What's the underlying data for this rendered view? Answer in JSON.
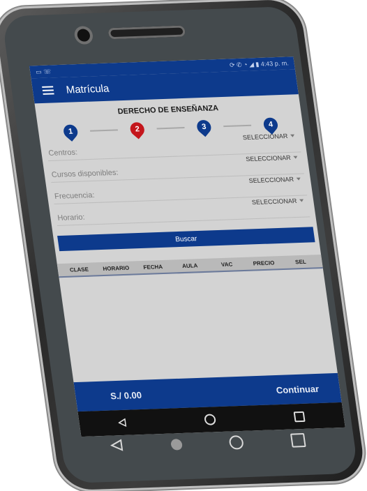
{
  "status_bar": {
    "left_icons": "▭ ☏",
    "right_text": "⟳ ✆ ◔ ◢ ▮ 4:43 p. m."
  },
  "app_bar": {
    "title": "Matrícula",
    "menu_icon": "hamburger-icon"
  },
  "section": {
    "title": "DERECHO DE ENSEÑANZA"
  },
  "steps": [
    {
      "label": "1",
      "active": false
    },
    {
      "label": "2",
      "active": true
    },
    {
      "label": "3",
      "active": false
    },
    {
      "label": "4",
      "active": false
    }
  ],
  "form": {
    "rows": [
      {
        "label": "Centros:",
        "value": "SELECCIONAR"
      },
      {
        "label": "Cursos disponibles:",
        "value": "SELECCIONAR"
      },
      {
        "label": "Frecuencia:",
        "value": "SELECCIONAR"
      },
      {
        "label": "Horario:",
        "value": "SELECCIONAR"
      }
    ],
    "search_button": "Buscar"
  },
  "table": {
    "headers": [
      "CLASE",
      "HORARIO",
      "FECHA",
      "AULA",
      "VAC",
      "PRECIO",
      "SEL"
    ]
  },
  "footer": {
    "total": "S./ 0.00",
    "continue_label": "Continuar"
  },
  "colors": {
    "primary": "#0d3a8c",
    "active_step": "#c4161c",
    "background": "#d3d3d3"
  }
}
